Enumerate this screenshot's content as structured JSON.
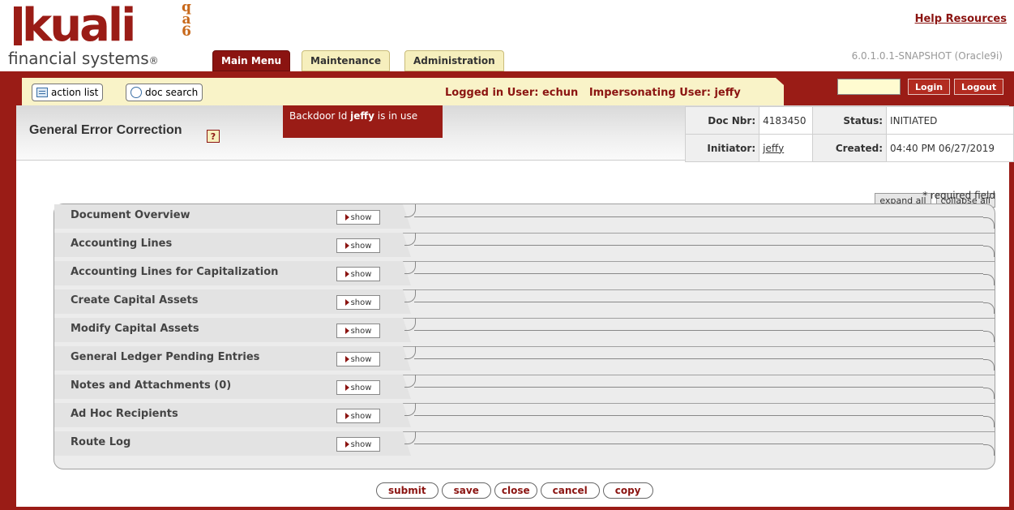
{
  "logo": {
    "word": "kuali",
    "stack": [
      "q",
      "a",
      "6"
    ],
    "subtitle": "financial systems",
    "registered": "®"
  },
  "header": {
    "help_link": "Help Resources",
    "version": "6.0.1.0.1-SNAPSHOT (Oracle9i)",
    "tabs": [
      {
        "label": "Main Menu",
        "active": true
      },
      {
        "label": "Maintenance",
        "active": false
      },
      {
        "label": "Administration",
        "active": false
      }
    ]
  },
  "toolbar": {
    "action_list_label": "action list",
    "doc_search_label": "doc search",
    "logged_in_text": "Logged in User: echun   Impersonating User: jeffy",
    "login_value": "",
    "login_label": "Login",
    "logout_label": "Logout"
  },
  "document": {
    "title": "General Error Correction",
    "help_symbol": "?",
    "backdoor_prefix": "Backdoor Id ",
    "backdoor_user": "jeffy",
    "backdoor_suffix": " is in use",
    "doc_nbr_label": "Doc Nbr:",
    "doc_nbr": "4183450",
    "status_label": "Status:",
    "status": "INITIATED",
    "initiator_label": "Initiator:",
    "initiator": "jeffy",
    "created_label": "Created:",
    "created": "04:40 PM 06/27/2019"
  },
  "controls": {
    "expand_all": "expand all",
    "collapse_all": "collapse all",
    "required_note": "* required field"
  },
  "sections": [
    {
      "label": "Document Overview",
      "show": "show"
    },
    {
      "label": "Accounting Lines",
      "show": "show"
    },
    {
      "label": "Accounting Lines for Capitalization",
      "show": "show"
    },
    {
      "label": "Create Capital Assets",
      "show": "show"
    },
    {
      "label": "Modify Capital Assets",
      "show": "show"
    },
    {
      "label": "General Ledger Pending Entries",
      "show": "show"
    },
    {
      "label": "Notes and Attachments (0)",
      "show": "show"
    },
    {
      "label": "Ad Hoc Recipients",
      "show": "show"
    },
    {
      "label": "Route Log",
      "show": "show"
    }
  ],
  "actions": {
    "submit": "submit",
    "save": "save",
    "close": "close",
    "cancel": "cancel",
    "copy": "copy"
  },
  "colors": {
    "brand_red": "#9a1c16",
    "accent_orange": "#c8691b",
    "tab_yellow": "#f6efbd"
  }
}
